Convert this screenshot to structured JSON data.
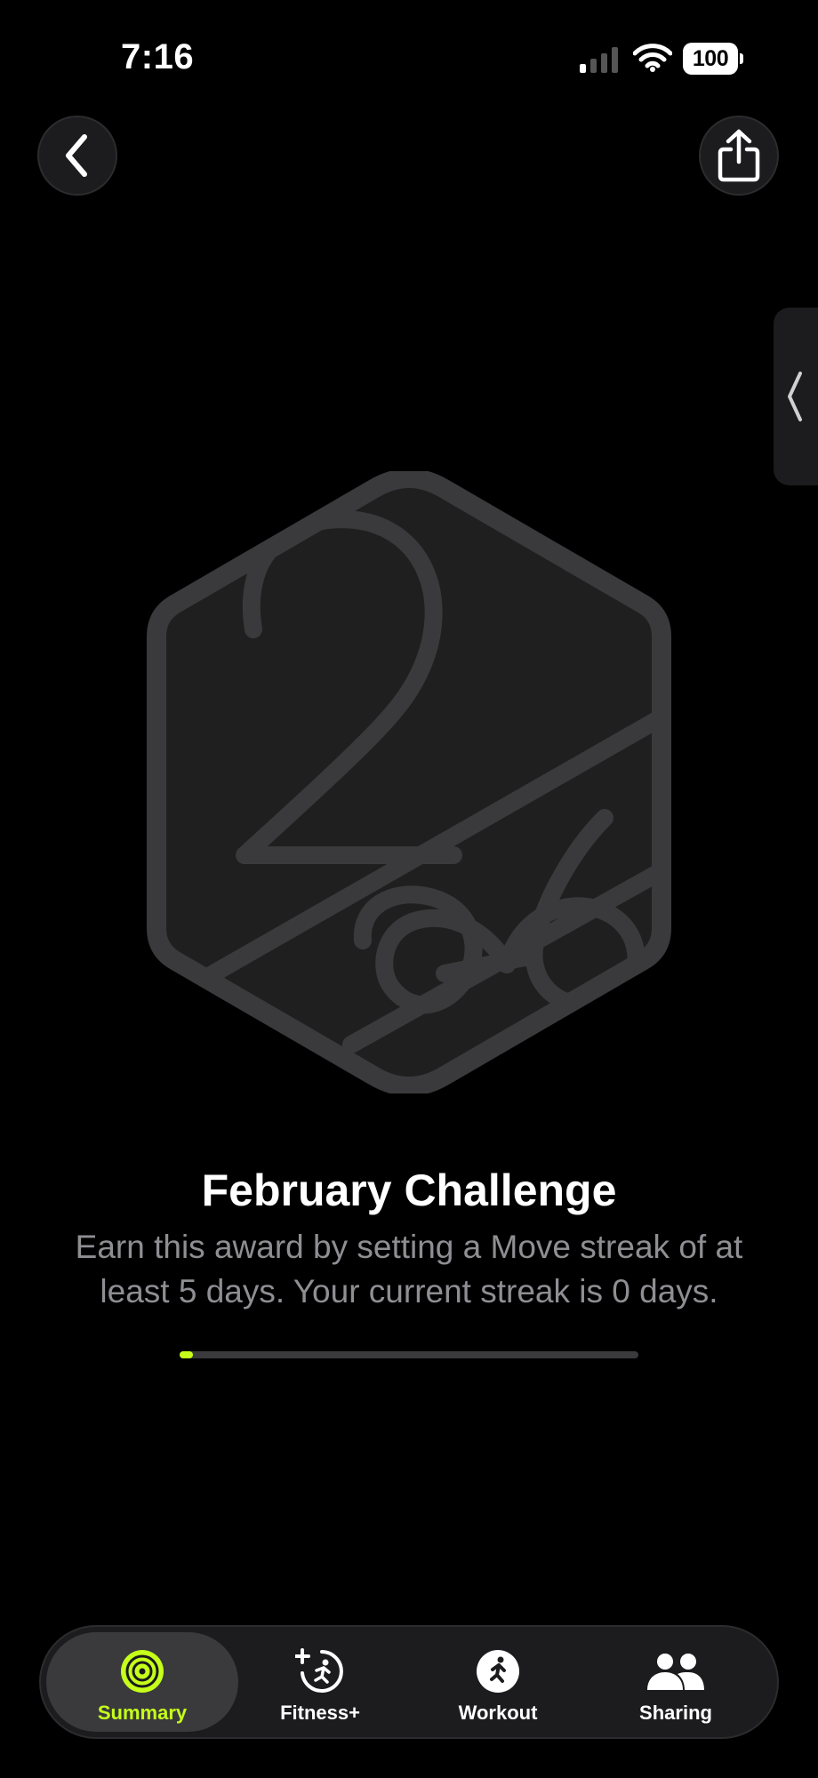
{
  "status_bar": {
    "time": "7:16",
    "battery": "100"
  },
  "nav": {
    "back_icon": "chevron-left-icon",
    "share_icon": "share-icon",
    "side_tab_icon": "chevron-left-icon"
  },
  "award": {
    "badge_icon": "february-2026-challenge-badge",
    "title": "February Challenge",
    "description": "Earn this award by setting a Move streak of at least 5 days. Your current streak is 0 days.",
    "progress": 0,
    "progress_color": "#c5ff1a"
  },
  "tabs": [
    {
      "label": "Summary",
      "icon": "activity-rings-icon",
      "active": true
    },
    {
      "label": "Fitness+",
      "icon": "fitness-plus-icon",
      "active": false
    },
    {
      "label": "Workout",
      "icon": "workout-runner-icon",
      "active": false
    },
    {
      "label": "Sharing",
      "icon": "people-icon",
      "active": false
    }
  ],
  "colors": {
    "accent": "#c5ff1a",
    "background": "#000000",
    "secondary_text": "#8e8e93"
  }
}
